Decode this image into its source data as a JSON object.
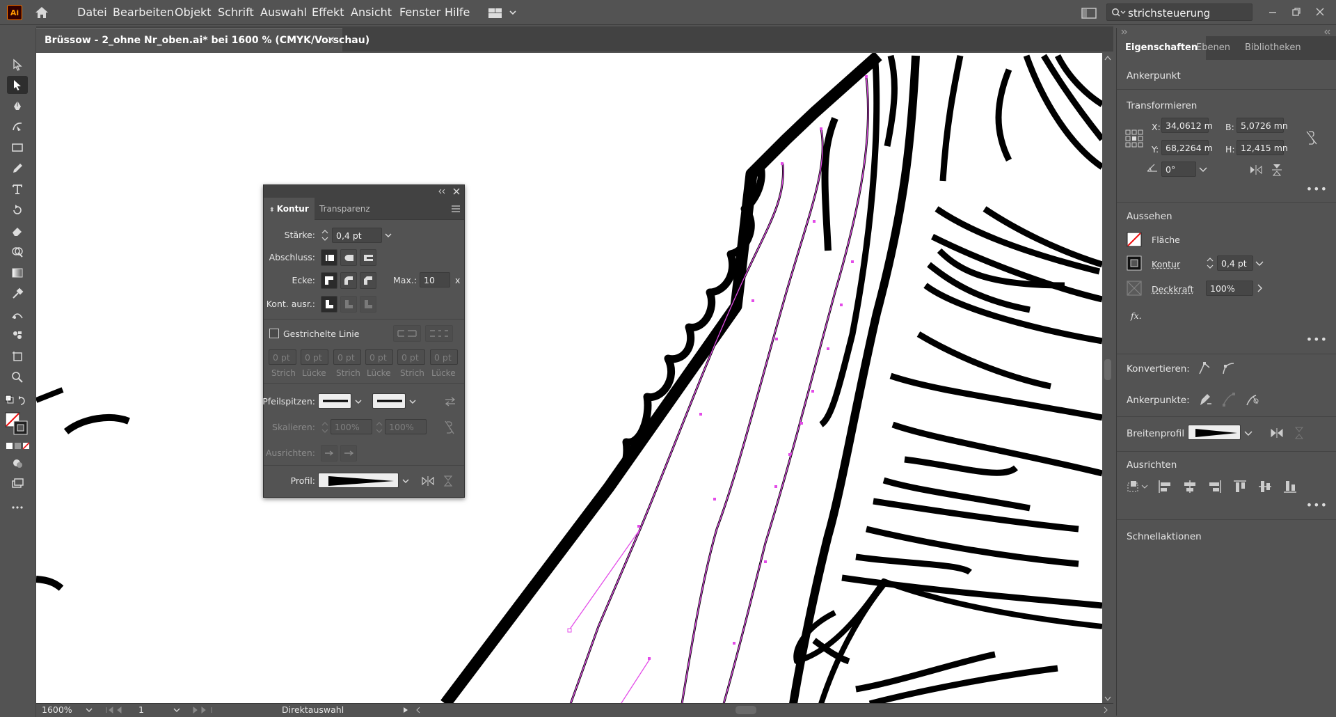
{
  "app": {
    "logo": "Ai",
    "menu": [
      "Datei",
      "Bearbeiten",
      "Objekt",
      "Schrift",
      "Auswahl",
      "Effekt",
      "Ansicht",
      "Fenster",
      "Hilfe"
    ],
    "search_value": "strichsteuerung"
  },
  "document_tab": {
    "title": "Brüssow - 2_ohne Nr_oben.ai* bei 1600 % (CMYK/Vorschau)",
    "close": "×"
  },
  "status": {
    "zoom": "1600%",
    "artboard": "1",
    "tool": "Direktauswahl"
  },
  "stroke_panel": {
    "tabs": [
      "Kontur",
      "Transparenz"
    ],
    "weight_label": "Stärke:",
    "weight_value": "0,4 pt",
    "cap_label": "Abschluss:",
    "corner_label": "Ecke:",
    "limit_label": "Max.:",
    "limit_value": "10",
    "limit_unit": "x",
    "align_label": "Kont. ausr.:",
    "dashed_label": "Gestrichelte Linie",
    "dash_fields": [
      "0 pt",
      "0 pt",
      "0 pt",
      "0 pt",
      "0 pt",
      "0 pt"
    ],
    "dash_labels": [
      "Strich",
      "Lücke",
      "Strich",
      "Lücke",
      "Strich",
      "Lücke"
    ],
    "arrowheads_label": "Pfeilspitzen:",
    "scale_label": "Skalieren:",
    "scale_values": [
      "100%",
      "100%"
    ],
    "align_arrows_label": "Ausrichten:",
    "profile_label": "Profil:"
  },
  "properties_panel": {
    "tabs": [
      "Eigenschaften",
      "Ebenen",
      "Bibliotheken"
    ],
    "selection_type": "Ankerpunkt",
    "transform": {
      "title": "Transformieren",
      "x_label": "X:",
      "x": "34,0612 m",
      "y_label": "Y:",
      "y": "68,2264 m",
      "w_label": "B:",
      "w": "5,0726 mn",
      "h_label": "H:",
      "h": "12,415 mn",
      "angle": "0°"
    },
    "appearance": {
      "title": "Aussehen",
      "fill_label": "Fläche",
      "stroke_label": "Kontur",
      "stroke_value": "0,4 pt",
      "opacity_label": "Deckkraft",
      "opacity_value": "100%",
      "fx": "fx."
    },
    "convert_label": "Konvertieren:",
    "anchors_label": "Ankerpunkte:",
    "width_profile_label": "Breitenprofil",
    "align_title": "Ausrichten",
    "quick_actions": "Schnellaktionen"
  },
  "colors": {
    "accent_path": "#e34ce8",
    "ui_bg": "#535353",
    "ui_dark": "#424242",
    "canvas": "#ffffff"
  }
}
